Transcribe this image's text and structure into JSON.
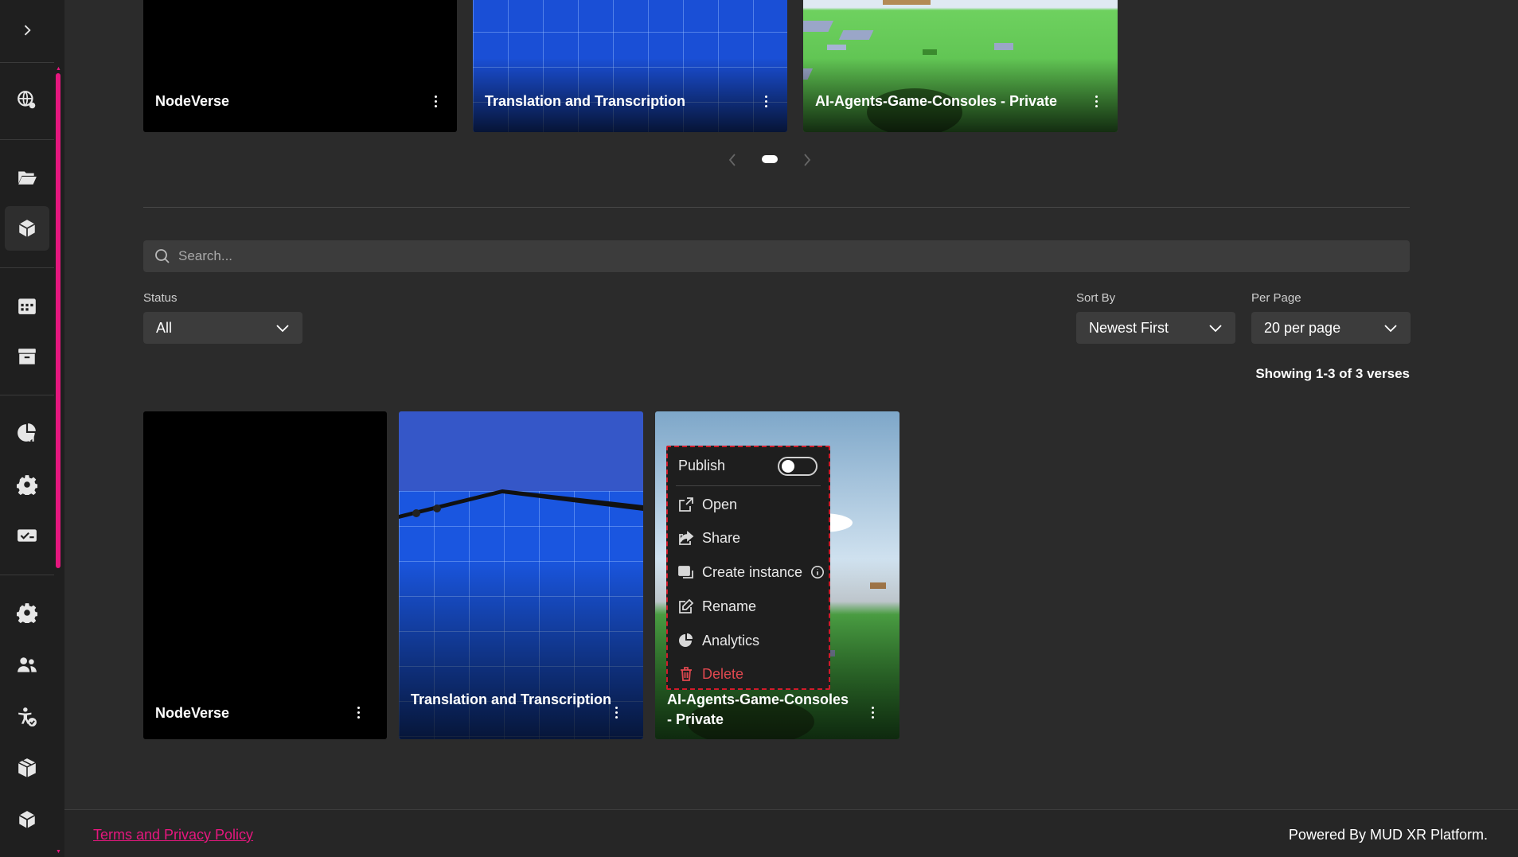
{
  "carousel": {
    "cards": [
      {
        "title": "NodeVerse"
      },
      {
        "title": "Translation and Transcription"
      },
      {
        "title": "AI-Agents-Game-Consoles - Private"
      }
    ]
  },
  "search": {
    "placeholder": "Search..."
  },
  "filters": {
    "status_label": "Status",
    "status_value": "All",
    "sort_label": "Sort By",
    "sort_value": "Newest First",
    "perpage_label": "Per Page",
    "perpage_value": "20 per page"
  },
  "showing": "Showing 1-3 of 3 verses",
  "grid": {
    "cards": [
      {
        "title": "NodeVerse"
      },
      {
        "title": "Translation and Transcription"
      },
      {
        "title": "AI-Agents-Game-Consoles - Private"
      }
    ]
  },
  "context_menu": {
    "publish": "Publish",
    "open": "Open",
    "share": "Share",
    "create_instance": "Create instance",
    "rename": "Rename",
    "analytics": "Analytics",
    "delete": "Delete",
    "delete_color": "#e0484f"
  },
  "footer": {
    "terms": "Terms and Privacy Policy",
    "powered": "Powered By MUD XR Platform."
  },
  "colors": {
    "accent": "#e5177e",
    "background": "#2b2b2b",
    "sidebar": "#1f1f1f"
  }
}
